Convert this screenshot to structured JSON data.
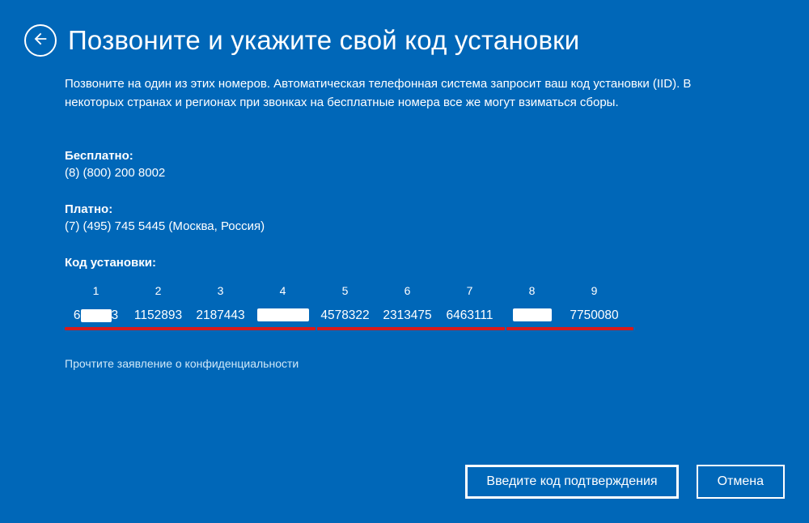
{
  "header": {
    "title": "Позвоните и укажите свой код установки"
  },
  "instruction": "Позвоните на один из этих номеров. Автоматическая телефонная система запросит ваш код установки (IID). В некоторых странах и регионах при звонках на бесплатные номера все же могут взиматься сборы.",
  "free": {
    "label": "Бесплатно:",
    "number": "(8) (800) 200 8002"
  },
  "paid": {
    "label": "Платно:",
    "number": "(7) (495) 745 5445 (Москва, Россия)"
  },
  "installCode": {
    "label": "Код установки:",
    "headers": [
      "1",
      "2",
      "3",
      "4",
      "5",
      "6",
      "7",
      "8",
      "9"
    ],
    "values": {
      "g1_prefix": "6",
      "g1_suffix": "3",
      "g2": "1152893",
      "g3": "2187443",
      "g5": "4578322",
      "g6": "2313475",
      "g7": "6463111",
      "g9": "7750080"
    }
  },
  "privacy": "Прочтите заявление о конфиденциальности",
  "buttons": {
    "confirm": "Введите код подтверждения",
    "cancel": "Отмена"
  }
}
